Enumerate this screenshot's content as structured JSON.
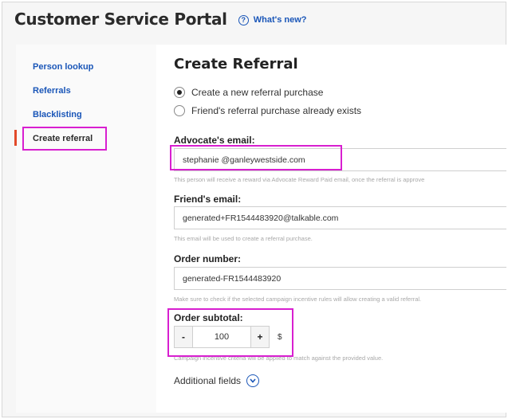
{
  "header": {
    "title": "Customer Service Portal",
    "whats_new": "What's new?"
  },
  "sidebar": {
    "items": [
      {
        "label": "Person lookup"
      },
      {
        "label": "Referrals"
      },
      {
        "label": "Blacklisting"
      },
      {
        "label": "Create referral"
      }
    ],
    "active_index": 3
  },
  "form": {
    "title": "Create Referral",
    "options": [
      {
        "label": "Create a new referral purchase",
        "selected": true
      },
      {
        "label": "Friend's referral purchase already exists",
        "selected": false
      }
    ],
    "advocate_email": {
      "label": "Advocate's email:",
      "value": "stephanie  @ganleywestside.com",
      "hint": "This person will receive a reward via Advocate Reward Paid email, once the referral is approve"
    },
    "friend_email": {
      "label": "Friend's email:",
      "value": "generated+FR1544483920@talkable.com",
      "hint": "This email will be used to create a referral purchase."
    },
    "order_number": {
      "label": "Order number:",
      "value": "generated-FR1544483920",
      "hint": "Make sure to check if the selected campaign incentive rules will allow creating a valid referral."
    },
    "order_subtotal": {
      "label": "Order subtotal:",
      "minus": "-",
      "value": "100",
      "plus": "+",
      "currency": "$",
      "hint": "Campaign incentive criteria will be applied to match against the provided value."
    },
    "additional_fields": "Additional fields"
  },
  "colors": {
    "accent": "#1a56b8",
    "highlight": "#d81fd0",
    "active_bar": "#e24a2a"
  },
  "icons": {
    "help": "question-circle-icon",
    "expand": "chevron-down-circle-icon"
  }
}
